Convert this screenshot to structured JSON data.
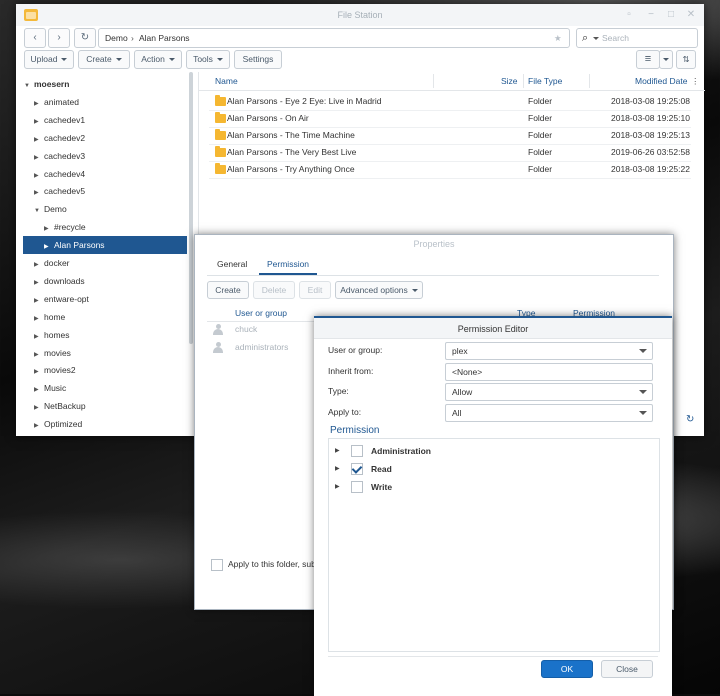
{
  "file_station": {
    "title": "File Station",
    "path": [
      "Demo",
      "Alan Parsons"
    ],
    "search_placeholder": "Search",
    "toolbar": {
      "upload": "Upload",
      "create": "Create",
      "action": "Action",
      "tools": "Tools",
      "settings": "Settings"
    },
    "tree": [
      {
        "label": "moesern",
        "arrow": "▼",
        "level": 0,
        "selected": false
      },
      {
        "label": "animated",
        "arrow": "▶",
        "level": 1,
        "selected": false
      },
      {
        "label": "cachedev1",
        "arrow": "▶",
        "level": 1,
        "selected": false
      },
      {
        "label": "cachedev2",
        "arrow": "▶",
        "level": 1,
        "selected": false
      },
      {
        "label": "cachedev3",
        "arrow": "▶",
        "level": 1,
        "selected": false
      },
      {
        "label": "cachedev4",
        "arrow": "▶",
        "level": 1,
        "selected": false
      },
      {
        "label": "cachedev5",
        "arrow": "▶",
        "level": 1,
        "selected": false
      },
      {
        "label": "Demo",
        "arrow": "▼",
        "level": 1,
        "selected": false
      },
      {
        "label": "#recycle",
        "arrow": "▶",
        "level": 2,
        "selected": false
      },
      {
        "label": "Alan Parsons",
        "arrow": "▶",
        "level": 2,
        "selected": true
      },
      {
        "label": "docker",
        "arrow": "▶",
        "level": 1,
        "selected": false
      },
      {
        "label": "downloads",
        "arrow": "▶",
        "level": 1,
        "selected": false
      },
      {
        "label": "entware-opt",
        "arrow": "▶",
        "level": 1,
        "selected": false
      },
      {
        "label": "home",
        "arrow": "▶",
        "level": 1,
        "selected": false
      },
      {
        "label": "homes",
        "arrow": "▶",
        "level": 1,
        "selected": false
      },
      {
        "label": "movies",
        "arrow": "▶",
        "level": 1,
        "selected": false
      },
      {
        "label": "movies2",
        "arrow": "▶",
        "level": 1,
        "selected": false
      },
      {
        "label": "Music",
        "arrow": "▶",
        "level": 1,
        "selected": false
      },
      {
        "label": "NetBackup",
        "arrow": "▶",
        "level": 1,
        "selected": false
      },
      {
        "label": "Optimized",
        "arrow": "▶",
        "level": 1,
        "selected": false
      }
    ],
    "columns": {
      "name": "Name",
      "size": "Size",
      "type": "File Type",
      "modified": "Modified Date"
    },
    "files": [
      {
        "name": "Alan Parsons - Eye 2 Eye: Live in Madrid",
        "type": "Folder",
        "modified": "2018-03-08 19:25:08"
      },
      {
        "name": "Alan Parsons - On Air",
        "type": "Folder",
        "modified": "2018-03-08 19:25:10"
      },
      {
        "name": "Alan Parsons - The Time Machine",
        "type": "Folder",
        "modified": "2018-03-08 19:25:13"
      },
      {
        "name": "Alan Parsons - The Very Best Live",
        "type": "Folder",
        "modified": "2019-06-26 03:52:58"
      },
      {
        "name": "Alan Parsons - Try Anything Once",
        "type": "Folder",
        "modified": "2018-03-08 19:25:22"
      }
    ]
  },
  "properties": {
    "title": "Properties",
    "tabs": [
      "General",
      "Permission"
    ],
    "active_tab": "Permission",
    "buttons": {
      "create": "Create",
      "delete": "Delete",
      "edit": "Edit",
      "advanced": "Advanced options"
    },
    "columns": {
      "user": "User or group",
      "type": "Type",
      "permission": "Permission"
    },
    "users": [
      "chuck",
      "administrators"
    ],
    "apply_text": "Apply to this folder, sub-fo"
  },
  "permission_editor": {
    "title": "Permission Editor",
    "fields": {
      "user_label": "User or group:",
      "user_value": "plex",
      "inherit_label": "Inherit from:",
      "inherit_value": "<None>",
      "type_label": "Type:",
      "type_value": "Allow",
      "apply_label": "Apply to:",
      "apply_value": "All"
    },
    "permission_heading": "Permission",
    "permissions": [
      {
        "label": "Administration",
        "checked": false
      },
      {
        "label": "Read",
        "checked": true
      },
      {
        "label": "Write",
        "checked": false
      }
    ],
    "ok": "OK",
    "close": "Close"
  },
  "icons": {
    "back": "‹",
    "forward": "›",
    "refresh": "↻",
    "search": "⌕",
    "star": "★",
    "menu": "≡",
    "sort": "⇅",
    "more": "⋮",
    "minimize": "−",
    "maximize": "□",
    "close": "✕",
    "pin": "▫"
  }
}
